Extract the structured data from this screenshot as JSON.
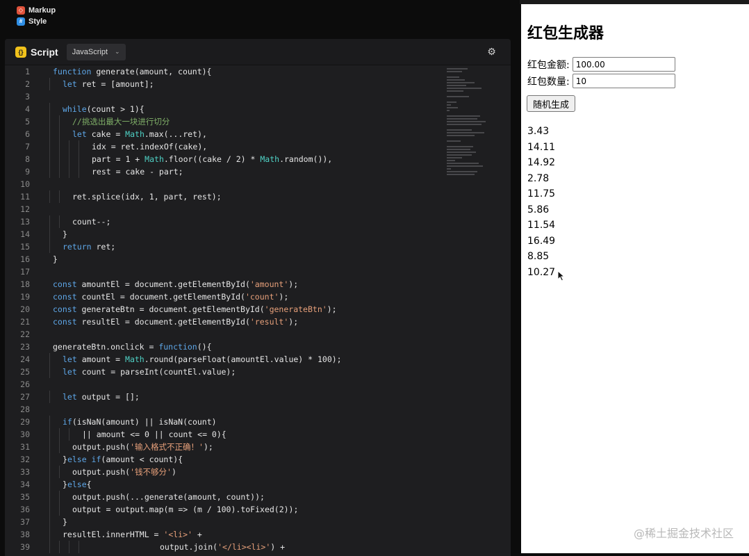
{
  "tabs": {
    "markup": {
      "icon": "html-icon",
      "label": "Markup"
    },
    "style": {
      "icon": "css-icon",
      "label": "Style"
    }
  },
  "script_panel": {
    "title": "Script",
    "language": "JavaScript",
    "settings_icon": "gear-icon"
  },
  "code_lines": [
    {
      "n": "1",
      "indent": 0,
      "html": "<span class=\"kw\">function</span> generate(amount, count){"
    },
    {
      "n": "2",
      "indent": 1,
      "html": "<span class=\"kw\">let</span> ret = [amount];"
    },
    {
      "n": "3",
      "indent": 0,
      "html": ""
    },
    {
      "n": "4",
      "indent": 1,
      "html": "<span class=\"kw\">while</span>(count > 1){"
    },
    {
      "n": "5",
      "indent": 2,
      "html": "<span class=\"cmt\">//挑选出最大一块进行切分</span>"
    },
    {
      "n": "6",
      "indent": 2,
      "html": "<span class=\"kw\">let</span> cake = <span class=\"fn-math\">Math</span>.max(...ret),"
    },
    {
      "n": "7",
      "indent": 4,
      "html": "idx = ret.indexOf(cake),"
    },
    {
      "n": "8",
      "indent": 4,
      "html": "part = 1 + <span class=\"fn-math\">Math</span>.floor((cake / 2) * <span class=\"fn-math\">Math</span>.random()),"
    },
    {
      "n": "9",
      "indent": 4,
      "html": "rest = cake - part;"
    },
    {
      "n": "10",
      "indent": 0,
      "html": ""
    },
    {
      "n": "11",
      "indent": 2,
      "html": "ret.splice(idx, 1, part, rest);"
    },
    {
      "n": "12",
      "indent": 0,
      "html": ""
    },
    {
      "n": "13",
      "indent": 2,
      "html": "count--;"
    },
    {
      "n": "14",
      "indent": 1,
      "html": "}"
    },
    {
      "n": "15",
      "indent": 1,
      "html": "<span class=\"kw\">return</span> ret;"
    },
    {
      "n": "16",
      "indent": 0,
      "html": "}"
    },
    {
      "n": "17",
      "indent": 0,
      "html": ""
    },
    {
      "n": "18",
      "indent": 0,
      "html": "<span class=\"kw\">const</span> amountEl = document.getElementById(<span class=\"str\">'amount'</span>);"
    },
    {
      "n": "19",
      "indent": 0,
      "html": "<span class=\"kw\">const</span> countEl = document.getElementById(<span class=\"str\">'count'</span>);"
    },
    {
      "n": "20",
      "indent": 0,
      "html": "<span class=\"kw\">const</span> generateBtn = document.getElementById(<span class=\"str\">'generateBtn'</span>);"
    },
    {
      "n": "21",
      "indent": 0,
      "html": "<span class=\"kw\">const</span> resultEl = document.getElementById(<span class=\"str\">'result'</span>);"
    },
    {
      "n": "22",
      "indent": 0,
      "html": ""
    },
    {
      "n": "23",
      "indent": 0,
      "html": "generateBtn.onclick = <span class=\"kw\">function</span>(){"
    },
    {
      "n": "24",
      "indent": 1,
      "html": "<span class=\"kw\">let</span> amount = <span class=\"fn-math\">Math</span>.round(parseFloat(amountEl.value) * 100);"
    },
    {
      "n": "25",
      "indent": 1,
      "html": "<span class=\"kw\">let</span> count = parseInt(countEl.value);"
    },
    {
      "n": "26",
      "indent": 0,
      "html": ""
    },
    {
      "n": "27",
      "indent": 1,
      "html": "<span class=\"kw\">let</span> output = [];"
    },
    {
      "n": "28",
      "indent": 0,
      "html": ""
    },
    {
      "n": "29",
      "indent": 1,
      "html": "<span class=\"kw\">if</span>(isNaN(amount) || isNaN(count)"
    },
    {
      "n": "30",
      "indent": 3,
      "html": "|| amount <= 0 || count <= 0){"
    },
    {
      "n": "31",
      "indent": 2,
      "html": "output.push(<span class=\"str\">'输入格式不正确！'</span>);"
    },
    {
      "n": "32",
      "indent": 1,
      "html": "}<span class=\"kw\">else if</span>(amount < count){"
    },
    {
      "n": "33",
      "indent": 2,
      "html": "output.push(<span class=\"str\">'钱不够分'</span>)"
    },
    {
      "n": "34",
      "indent": 1,
      "html": "}<span class=\"kw\">else</span>{"
    },
    {
      "n": "35",
      "indent": 2,
      "html": "output.push(...generate(amount, count));"
    },
    {
      "n": "36",
      "indent": 2,
      "html": "output = output.map(m => (m / 100).toFixed(2));"
    },
    {
      "n": "37",
      "indent": 1,
      "html": "}"
    },
    {
      "n": "38",
      "indent": 1,
      "html": "resultEl.innerHTML = <span class=\"str\">'&lt;li&gt;'</span> +"
    },
    {
      "n": "39",
      "indent": 11,
      "html": "output.join(<span class=\"str\">'&lt;/li&gt;&lt;li&gt;'</span>) +"
    }
  ],
  "preview": {
    "title": "红包生成器",
    "amount_label": "红包金额:",
    "amount_value": "100.00",
    "count_label": "红包数量:",
    "count_value": "10",
    "button_label": "随机生成",
    "results": [
      "3.43",
      "14.11",
      "14.92",
      "2.78",
      "11.75",
      "5.86",
      "11.54",
      "16.49",
      "8.85",
      "10.27"
    ]
  },
  "watermark": "@稀土掘金技术社区"
}
